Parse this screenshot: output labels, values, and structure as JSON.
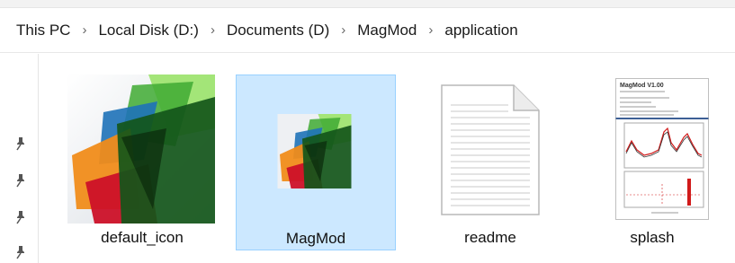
{
  "breadcrumb": {
    "items": [
      "This PC",
      "Local Disk (D:)",
      "Documents (D)",
      "MagMod",
      "application"
    ],
    "separator": "›"
  },
  "quick_access": {
    "pins": [
      "pin-icon",
      "pin-icon",
      "pin-icon",
      "pin-icon"
    ]
  },
  "files": [
    {
      "name": "default_icon",
      "type": "image",
      "selected": false
    },
    {
      "name": "MagMod",
      "type": "image",
      "selected": true
    },
    {
      "name": "readme",
      "type": "text-document",
      "selected": false
    },
    {
      "name": "splash",
      "type": "image",
      "selected": false
    }
  ],
  "splash_thumbnail": {
    "title": "MagMod V1.00"
  },
  "colors": {
    "selection_fill": "#cce8ff",
    "selection_border": "#99d1ff"
  }
}
